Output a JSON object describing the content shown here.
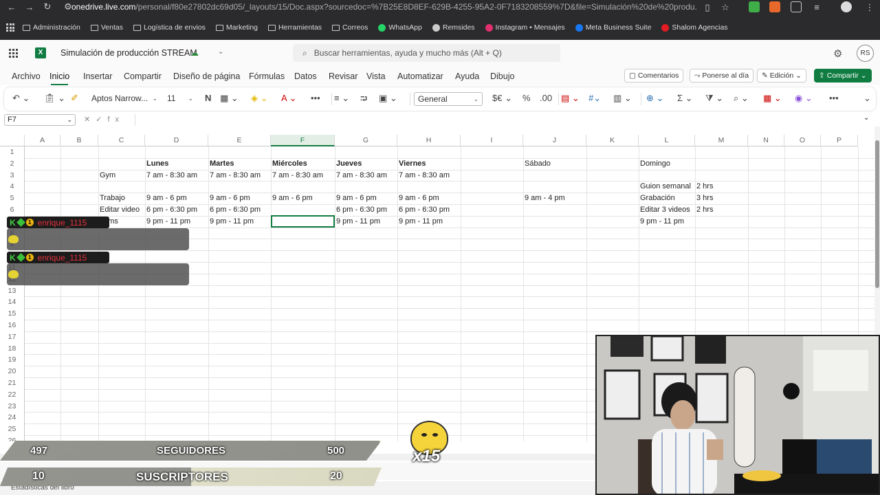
{
  "browser": {
    "url_domain": "onedrive.live.com",
    "url_rest": "/personal/f80e27802dc69d05/_layouts/15/Doc.aspx?sourcedoc=%7B25E8D8EF-629B-4255-95A2-0F7183208559%7D&file=Simulación%20de%20produ...",
    "bookmarks": [
      {
        "label": "Administración",
        "icon": "folder-icon"
      },
      {
        "label": "Ventas",
        "icon": "folder-icon"
      },
      {
        "label": "Logística de envios",
        "icon": "folder-icon"
      },
      {
        "label": "Marketing",
        "icon": "folder-icon"
      },
      {
        "label": "Herramientas",
        "icon": "folder-icon"
      },
      {
        "label": "Correos",
        "icon": "folder-icon"
      },
      {
        "label": "WhatsApp",
        "icon": "whatsapp-icon",
        "color": "#25d366"
      },
      {
        "label": "Remsides",
        "icon": "plane-icon",
        "color": "#cccccc"
      },
      {
        "label": "Instagram • Mensajes",
        "icon": "instagram-icon",
        "color": "#e1306c"
      },
      {
        "label": "Meta Business Suite",
        "icon": "meta-icon",
        "color": "#1877f2"
      },
      {
        "label": "Shalom Agencias",
        "icon": "shalom-icon",
        "color": "#e31b23"
      }
    ]
  },
  "excel": {
    "doc_title": "Simulación de producción STREAM",
    "logo_letter": "X",
    "search_placeholder": "Buscar herramientas, ayuda y mucho más (Alt + Q)",
    "avatar": "RS",
    "menu": [
      "Archivo",
      "Inicio",
      "Insertar",
      "Compartir",
      "Diseño de página",
      "Fórmulas",
      "Datos",
      "Revisar",
      "Vista",
      "Automatizar",
      "Ayuda",
      "Dibujo"
    ],
    "active_menu": "Inicio",
    "right_buttons": {
      "comments": "Comentarios",
      "catchup": "Ponerse al día",
      "editing": "Edición",
      "share": "Compartir"
    },
    "font_name": "Aptos Narrow...",
    "font_size": "11",
    "bold": "N",
    "number_format": "General",
    "currency": "$€",
    "name_box": "F7",
    "fx": "fx",
    "status_text": "Estadísticas del libro",
    "columns": [
      "A",
      "B",
      "C",
      "D",
      "E",
      "F",
      "G",
      "H",
      "I",
      "J",
      "K",
      "L",
      "M",
      "N",
      "O",
      "P"
    ],
    "selected_column": "F",
    "rows": [
      "1",
      "2",
      "3",
      "4",
      "5",
      "6",
      "7",
      "8",
      "9",
      "10",
      "11",
      "12",
      "13",
      "14",
      "15",
      "16",
      "17",
      "18",
      "19",
      "20",
      "21",
      "22",
      "23",
      "24",
      "25",
      "26"
    ],
    "cells": {
      "d2": "Lunes",
      "e2": "Martes",
      "f2": "Miércoles",
      "g2": "Jueves",
      "h2": "Viernes",
      "j2": "Sábado",
      "l2": "Domingo",
      "c3": "Gym",
      "d3": "7 am - 8:30 am",
      "e3": "7 am - 8:30 am",
      "f3": "7 am - 8:30 am",
      "g3": "7 am - 8:30 am",
      "h3": "7 am - 8:30 am",
      "l4": "Guion semanal",
      "m4": "2 hrs",
      "c5": "Trabajo",
      "d5": "9 am - 6 pm",
      "e5": "9 am - 6 pm",
      "f5": "9 am - 6 pm",
      "g5": "9 am - 6 pm",
      "h5": "9 am - 6 pm",
      "j5": "9 am - 4 pm",
      "l5": "Grabación",
      "m5": "3 hrs",
      "c6": "Editar video",
      "d6": "6 pm - 6:30 pm",
      "e6": "6 pm - 6:30 pm",
      "g6": "6 pm - 6:30 pm",
      "h6": "6 pm - 6:30 pm",
      "l6": "Editar 3 videos",
      "m6": "2 hrs",
      "c7": "eams",
      "d7": "9 pm - 11 pm",
      "e7": "9 pm - 11 pm",
      "g7": "9 pm - 11 pm",
      "h7": "9 pm - 11 pm",
      "l7": "9 pm - 11 pm"
    }
  },
  "overlay": {
    "chat": [
      {
        "badge": "K",
        "user": "enrique_1115"
      },
      {
        "badge": "K",
        "user": "enrique_1115"
      }
    ],
    "followers": {
      "current": "497",
      "label": "SEGUIDORES",
      "goal": "500",
      "progress": 0.994
    },
    "subscribers": {
      "current": "10",
      "label": "SUSCRIPTORES",
      "goal": "20",
      "progress": 0.5
    },
    "multiplier": "x15"
  },
  "colors": {
    "excel_green": "#107c41",
    "chrome_dark": "#2b2b2e",
    "chat_user": "#e8323c"
  }
}
